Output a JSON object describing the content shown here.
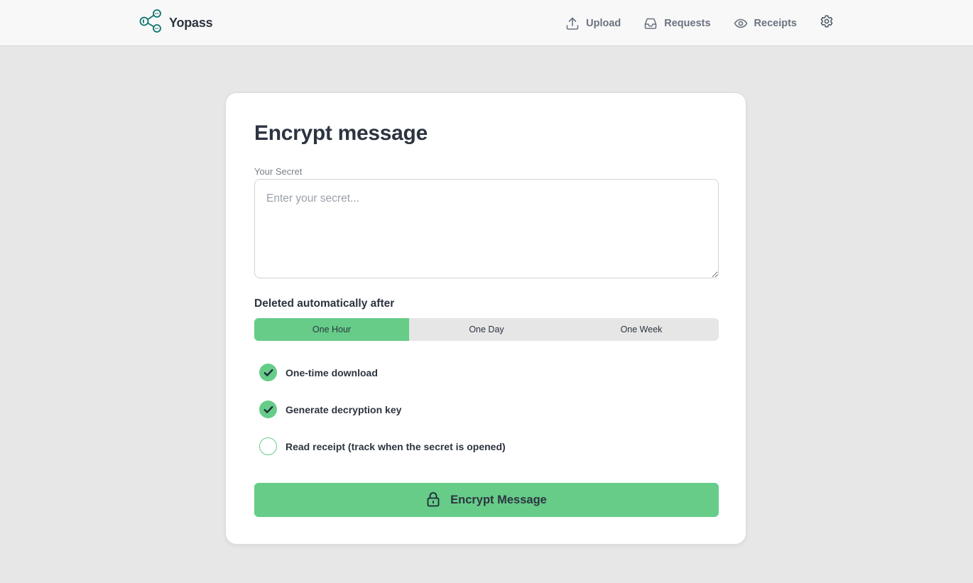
{
  "app": {
    "brand": "Yopass"
  },
  "nav": {
    "upload": "Upload",
    "requests": "Requests",
    "receipts": "Receipts"
  },
  "form": {
    "title": "Encrypt message",
    "secret_label": "Your Secret",
    "secret_placeholder": "Enter your secret...",
    "secret_value": "",
    "expiry_label": "Deleted automatically after",
    "expiry_options": [
      {
        "label": "One Hour",
        "selected": true
      },
      {
        "label": "One Day",
        "selected": false
      },
      {
        "label": "One Week",
        "selected": false
      }
    ],
    "options": [
      {
        "label": "One-time download",
        "checked": true
      },
      {
        "label": "Generate decryption key",
        "checked": true
      },
      {
        "label": "Read receipt (track when the secret is opened)",
        "checked": false
      }
    ],
    "submit_label": "Encrypt Message"
  },
  "icons": {
    "logo": "share-nodes-icon",
    "upload": "upload-icon",
    "requests": "inbox-icon",
    "receipts": "eye-icon",
    "settings": "gear-icon",
    "checked": "check-icon",
    "submit": "lock-icon"
  },
  "colors": {
    "accent": "#66cc88",
    "logo": "#0f766e",
    "page_background": "#e7e7e7",
    "text": "#2d3440",
    "muted_text": "#6b7280"
  }
}
